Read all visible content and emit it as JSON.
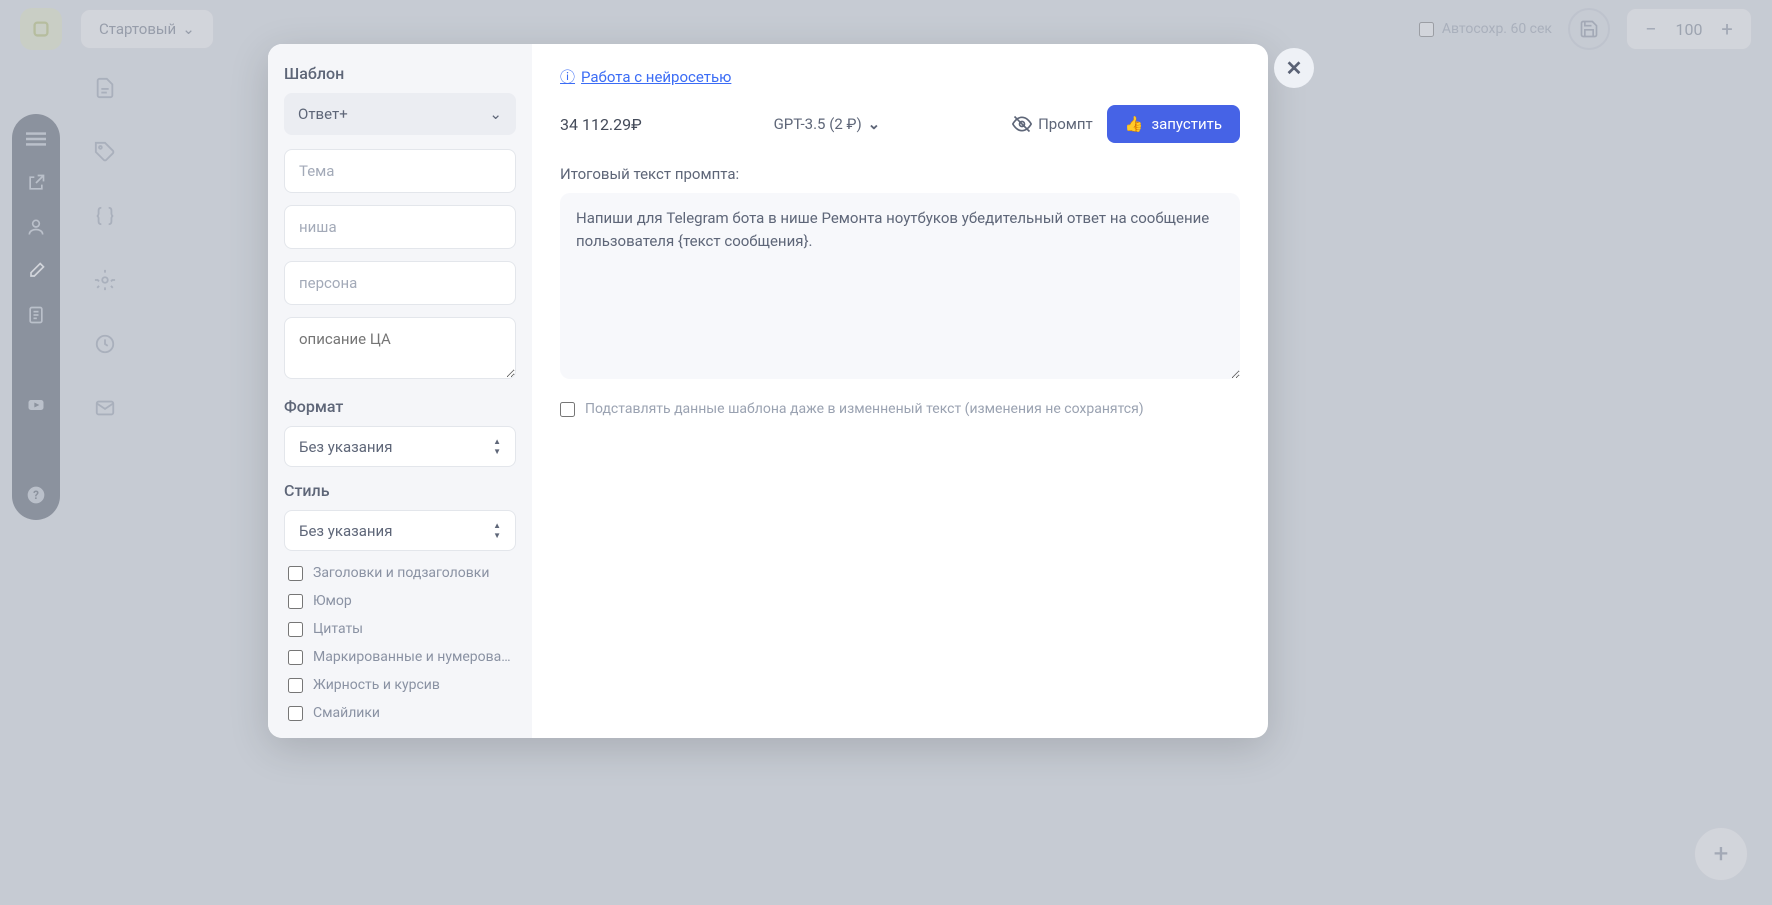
{
  "topbar": {
    "startDropdown": "Стартовый",
    "autosaveLabel": "Автосохр. 60 сек",
    "zoomValue": "100"
  },
  "modal": {
    "left": {
      "templateLabel": "Шаблон",
      "templateValue": "Ответ+",
      "themePlaceholder": "Тема",
      "nichePlaceholder": "ниша",
      "personaPlaceholder": "персона",
      "audiencePlaceholder": "описание ЦА",
      "formatLabel": "Формат",
      "formatValue": "Без указания",
      "styleLabel": "Стиль",
      "styleValue": "Без указания",
      "checkboxes": {
        "headings": "Заголовки и подзаголовки",
        "humor": "Юмор",
        "quotes": "Цитаты",
        "lists": "Маркированные и нумерован...",
        "bold": "Жирность и курсив",
        "emoji": "Смайлики"
      }
    },
    "right": {
      "helpLink": "Работа с нейросетью",
      "balance": "34 112.29₽",
      "model": "GPT-3.5 (2 ₽)",
      "promptToggle": "Промпт",
      "runButton": "запустить",
      "promptLabel": "Итоговый текст промпта:",
      "promptText": "Напиши для Telegram бота в нише Ремонта ноутбуков убедительный ответ на сообщение пользователя {текст сообщения}.",
      "substituteLabel": "Подставлять данные шаблона даже в изменненый текст (изменения не сохранятся)"
    }
  }
}
